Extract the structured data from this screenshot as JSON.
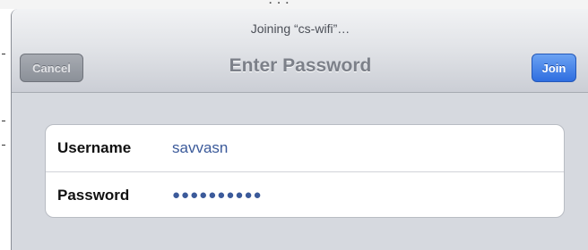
{
  "dialog": {
    "prompt": "Joining “cs-wifi”…",
    "title": "Enter Password",
    "cancel_label": "Cancel",
    "join_label": "Join"
  },
  "form": {
    "fields": [
      {
        "label": "Username",
        "value": "savvasn"
      },
      {
        "label": "Password",
        "value": "●●●●●●●●●●"
      }
    ]
  },
  "colors": {
    "join_button": "#3a78e6",
    "cancel_button": "#979ba3",
    "field_value_text": "#3b5a9a",
    "background": "#d6d9df"
  }
}
